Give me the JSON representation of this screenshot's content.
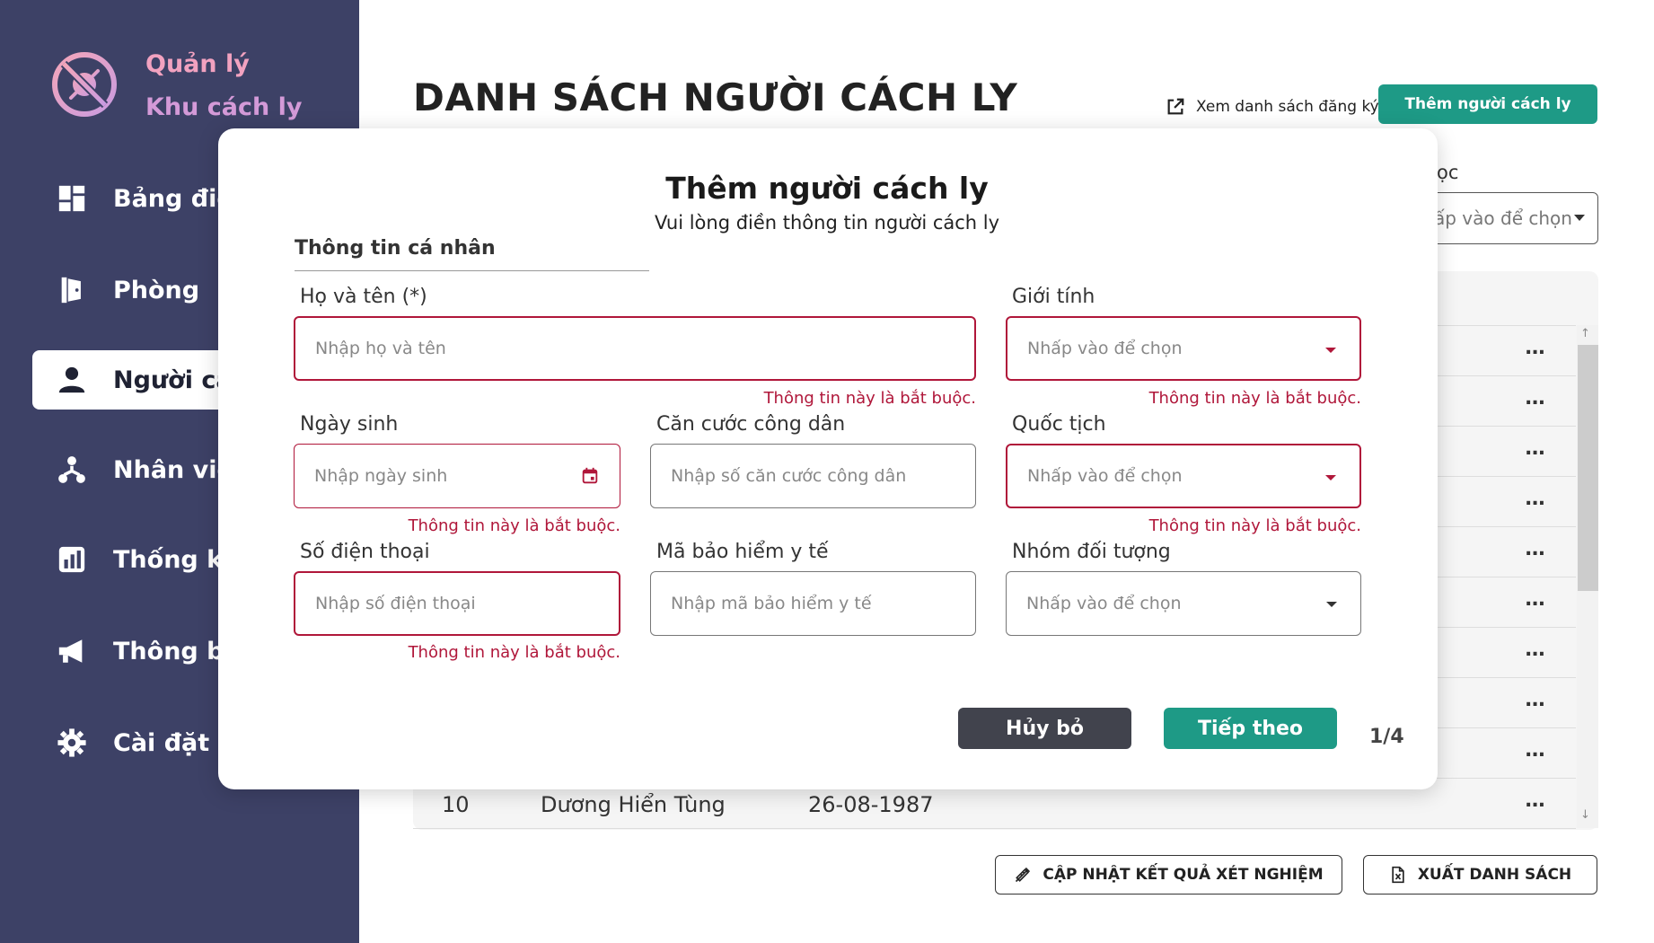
{
  "sidebar": {
    "brand_line1": "Quản lý",
    "brand_line2": "Khu cách ly",
    "items": [
      {
        "label": "Bảng điều",
        "icon": "dashboard-icon",
        "active": false
      },
      {
        "label": "Phòng",
        "icon": "door-icon",
        "active": false
      },
      {
        "label": "Người các",
        "icon": "person-icon",
        "active": true
      },
      {
        "label": "Nhân viên",
        "icon": "staff-icon",
        "active": false
      },
      {
        "label": "Thống kê",
        "icon": "chart-icon",
        "active": false
      },
      {
        "label": "Thông bá",
        "icon": "megaphone-icon",
        "active": false
      },
      {
        "label": "Cài đặt",
        "icon": "gear-icon",
        "active": false
      }
    ]
  },
  "header": {
    "title": "DANH SÁCH NGƯỜI CÁCH LY",
    "view_list_link": "Xem danh sách đăng ký",
    "add_button": "Thêm người cách ly"
  },
  "filter": {
    "label": "ọc",
    "placeholder": "ấp vào để chọn"
  },
  "table": {
    "visible_row": {
      "index": "10",
      "name": "Dương Hiển Tùng",
      "dob": "26-08-1987"
    },
    "row_action": "...",
    "scroll_up": "↑",
    "scroll_down": "↓"
  },
  "footer": {
    "update_button": "CẬP NHẬT KẾT QUẢ XÉT NGHIỆM",
    "export_button": "XUẤT DANH SÁCH"
  },
  "modal": {
    "title": "Thêm người cách ly",
    "subtitle": "Vui lòng điền thông tin người cách ly",
    "section_tab": "Thông tin cá nhân",
    "fields": {
      "fullname": {
        "label": "Họ và tên (*)",
        "placeholder": "Nhập họ và tên",
        "error": "Thông tin này là bắt buộc."
      },
      "gender": {
        "label": "Giới tính",
        "placeholder": "Nhấp vào để chọn",
        "error": "Thông tin này là bắt buộc."
      },
      "dob": {
        "label": "Ngày sinh",
        "placeholder": "Nhập ngày sinh",
        "error": "Thông tin này là bắt buộc."
      },
      "id_card": {
        "label": "Căn cước công dân",
        "placeholder": "Nhập số căn cước công dân"
      },
      "nationality": {
        "label": "Quốc tịch",
        "placeholder": "Nhấp vào để chọn",
        "error": "Thông tin này là bắt buộc."
      },
      "phone": {
        "label": "Số điện thoại",
        "placeholder": "Nhập số điện thoại",
        "error": "Thông tin này là bắt buộc."
      },
      "insurance": {
        "label": "Mã bảo hiểm y tế",
        "placeholder": "Nhập mã bảo hiểm y tế"
      },
      "group": {
        "label": "Nhóm đối tượng",
        "placeholder": "Nhấp vào để chọn"
      }
    },
    "cancel_button": "Hủy bỏ",
    "next_button": "Tiếp theo",
    "step": "1/4"
  },
  "colors": {
    "sidebar_bg": "#3d4166",
    "accent": "#1e9a86",
    "error": "#b0173a",
    "brand_pink": "#f2a2c0"
  }
}
